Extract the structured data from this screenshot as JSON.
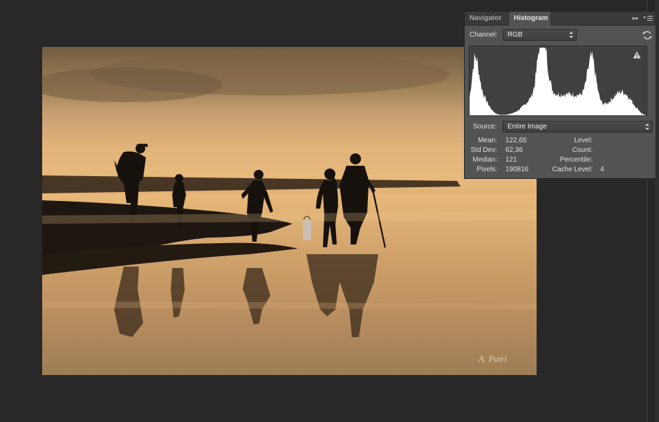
{
  "panel": {
    "tabs": [
      {
        "label": "Navigator",
        "active": false
      },
      {
        "label": "Histogram",
        "active": true
      }
    ],
    "channel_label": "Channel:",
    "channel_value": "RGB",
    "source_label": "Source:",
    "source_value": "Entire Image",
    "stats_left": [
      {
        "label": "Mean:",
        "value": "122,65"
      },
      {
        "label": "Std Dev:",
        "value": "62,36"
      },
      {
        "label": "Median:",
        "value": "121"
      },
      {
        "label": "Pixels:",
        "value": "190816"
      }
    ],
    "stats_right": [
      {
        "label": "Level:",
        "value": ""
      },
      {
        "label": "Count:",
        "value": ""
      },
      {
        "label": "Percentile:",
        "value": ""
      },
      {
        "label": "Cache Level:",
        "value": "4"
      }
    ],
    "icons": {
      "refresh": "refresh-icon",
      "warning": "warning-icon",
      "collapse": "double-chevron-right-icon",
      "menu": "panel-menu-icon"
    }
  },
  "image": {
    "watermark": "A. Putri"
  },
  "colors": {
    "panel_bg": "#535353",
    "workspace_bg": "#282828",
    "histogram_fill": "#ffffff"
  }
}
